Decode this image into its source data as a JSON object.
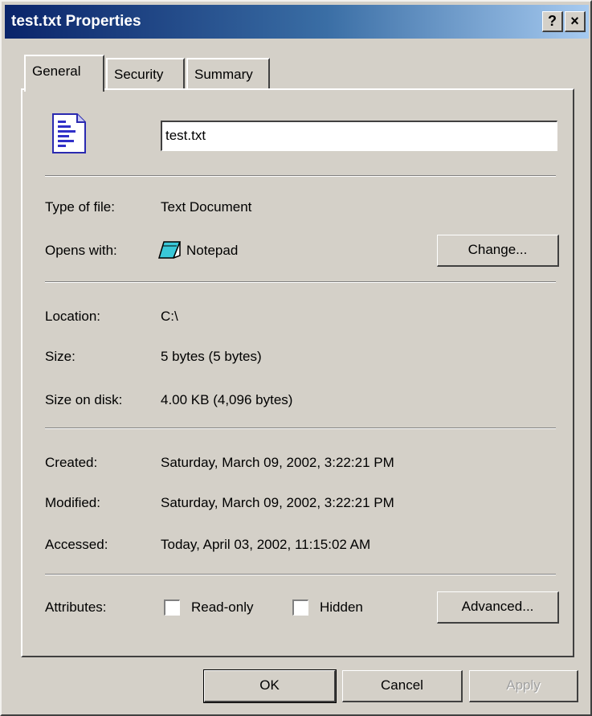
{
  "window": {
    "title": "test.txt Properties",
    "help_label": "?",
    "close_label": "×"
  },
  "tabs": [
    {
      "label": "General",
      "active": true
    },
    {
      "label": "Security",
      "active": false
    },
    {
      "label": "Summary",
      "active": false
    }
  ],
  "general": {
    "file_icon": "text-file-icon",
    "file_name": "test.txt",
    "type_label": "Type of file:",
    "type_value": "Text Document",
    "opens_label": "Opens with:",
    "opens_icon": "notepad-icon",
    "opens_value": "Notepad",
    "change_button": "Change...",
    "location_label": "Location:",
    "location_value": "C:\\",
    "size_label": "Size:",
    "size_value": "5 bytes (5 bytes)",
    "disk_label": "Size on disk:",
    "disk_value": "4.00 KB (4,096 bytes)",
    "created_label": "Created:",
    "created_value": "Saturday, March 09, 2002, 3:22:21 PM",
    "modified_label": "Modified:",
    "modified_value": "Saturday, March 09, 2002, 3:22:21 PM",
    "accessed_label": "Accessed:",
    "accessed_value": "Today, April 03, 2002, 11:15:02 AM",
    "attributes_label": "Attributes:",
    "readonly_label": "Read-only",
    "readonly_checked": false,
    "hidden_label": "Hidden",
    "hidden_checked": false,
    "advanced_button": "Advanced..."
  },
  "footer": {
    "ok_label": "OK",
    "cancel_label": "Cancel",
    "apply_label": "Apply",
    "apply_enabled": false
  },
  "colors": {
    "face": "#d4d0c8",
    "title_start": "#0a246a",
    "title_end": "#a6caf0"
  }
}
